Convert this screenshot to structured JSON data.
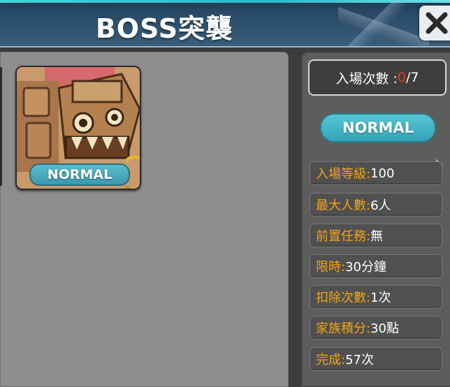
{
  "header": {
    "title": "BOSS突襲",
    "close_icon": "close-icon"
  },
  "boss_card": {
    "difficulty": "NORMAL",
    "image": "stone-golem-boss-portrait"
  },
  "entry": {
    "label": "入場次數 : ",
    "used": "0",
    "separator": " / ",
    "max": "7"
  },
  "difficulty_selected": "NORMAL",
  "info": [
    {
      "label": "入場等級:",
      "value": " 100"
    },
    {
      "label": "最大人數:",
      "value": " 6人"
    },
    {
      "label": "前置任務:",
      "value": " 無"
    },
    {
      "label": "限時:",
      "value": " 30分鐘"
    },
    {
      "label": "扣除次數:",
      "value": " 1次"
    },
    {
      "label": "家族積分:",
      "value": " 30點"
    },
    {
      "label": "完成:",
      "value": " 57次"
    }
  ],
  "colors": {
    "label_orange": "#f0a418",
    "count_red": "#e23a2e",
    "badge_teal": "#3fb0c4"
  }
}
